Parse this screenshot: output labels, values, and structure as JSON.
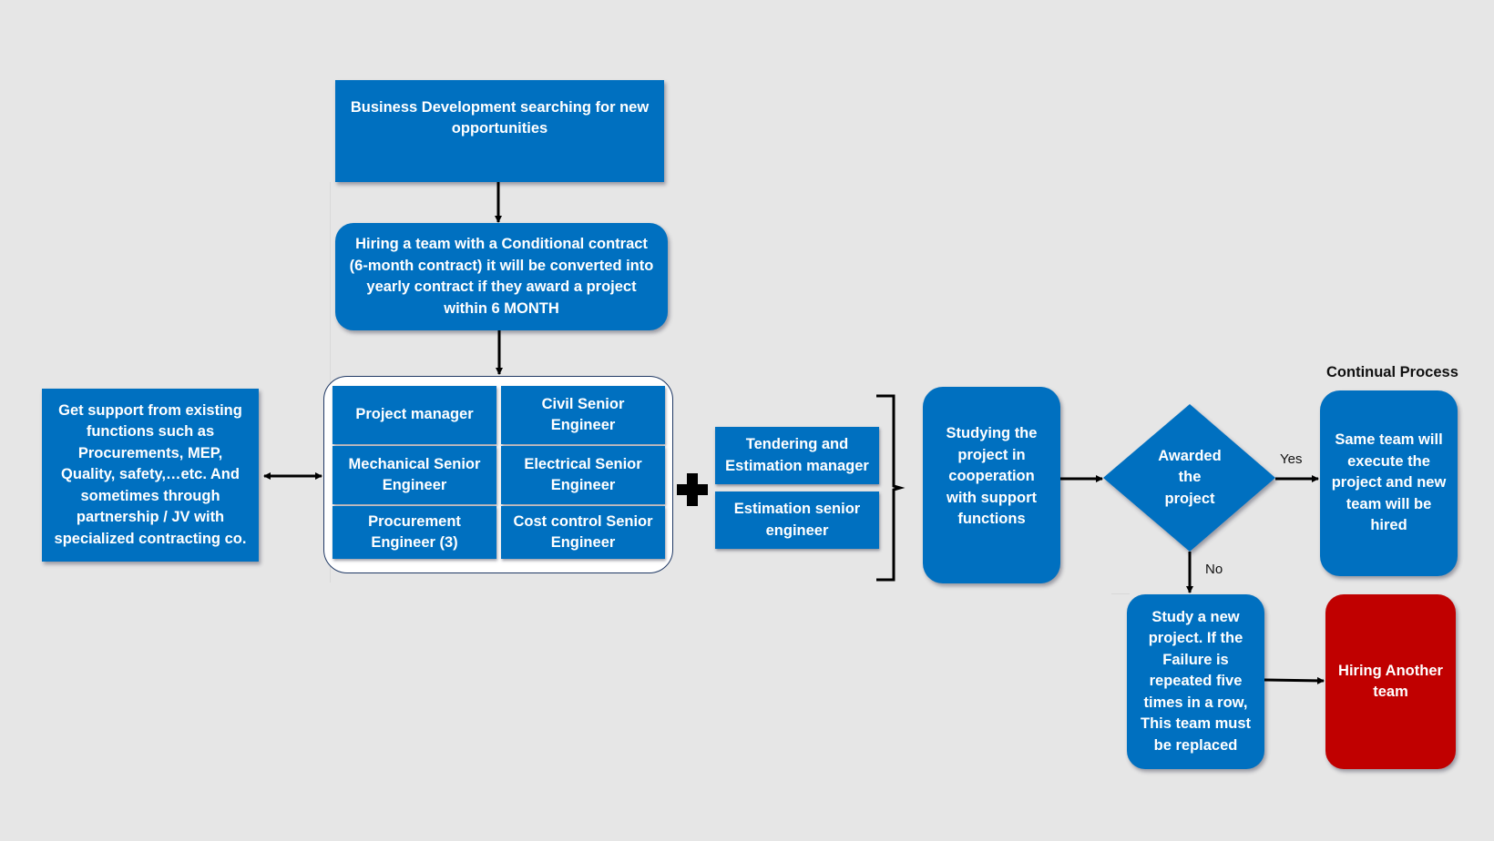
{
  "colors": {
    "node_blue": "#0070c0",
    "node_red": "#c00000",
    "background": "#e6e6e6",
    "connector": "#000000"
  },
  "nodes": {
    "business_development": "Business Development searching for new opportunities",
    "hiring_team": "Hiring a team with a Conditional contract (6-month contract) it will be converted into yearly contract if they award a project within 6 MONTH",
    "support_functions": "Get support from existing functions such as Procurements, MEP, Quality, safety,…etc. And sometimes through partnership / JV with specialized contracting co.",
    "team_roles": [
      "Project manager",
      "Civil Senior Engineer",
      "Mechanical Senior Engineer",
      "Electrical Senior Engineer",
      "Procurement Engineer (3)",
      "Cost control Senior Engineer"
    ],
    "tendering_roles": [
      "Tendering and Estimation manager",
      "Estimation senior engineer"
    ],
    "studying": "Studying the project in cooperation with support functions",
    "decision": "Awarded the project",
    "same_team": "Same team will execute the project and new team will be hired",
    "study_new": "Study a new project. If the Failure is repeated five times in a row, This team must be replaced",
    "hiring_another": "Hiring Another team"
  },
  "labels": {
    "yes": "Yes",
    "no": "No",
    "continual_process": "Continual Process"
  },
  "icons": {
    "plus": "plus-icon",
    "bracket": "right-curly-bracket",
    "arrow": "arrow-connector"
  }
}
